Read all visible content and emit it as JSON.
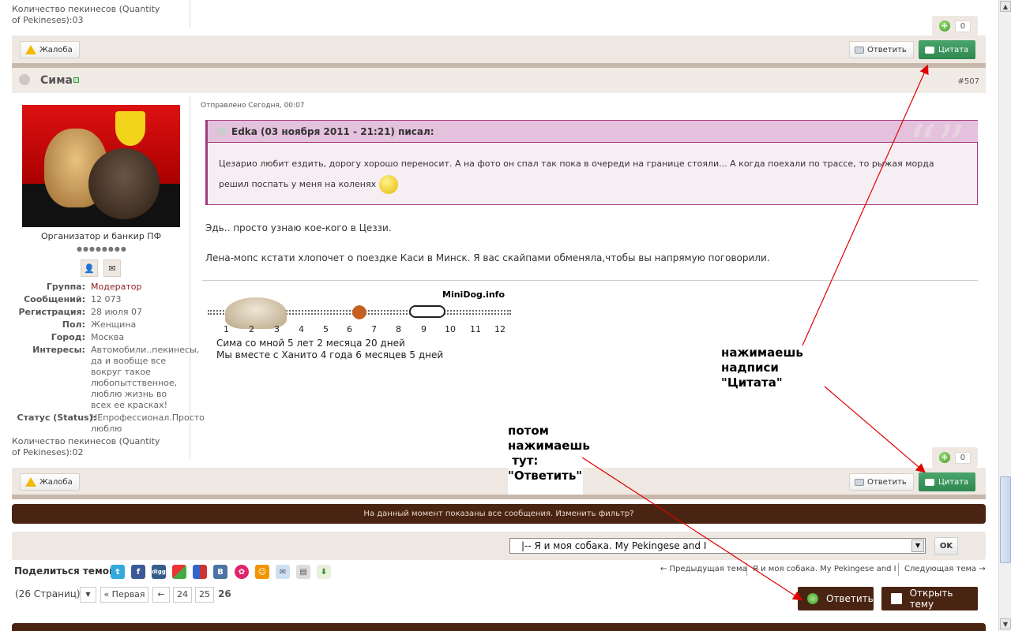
{
  "prev_post": {
    "pekingese_count": "Количество пекинесов (Quantity of Pekineses):03",
    "rep_count": "0",
    "report_label": "Жалоба",
    "reply_label": "Ответить",
    "quote_label": "Цитата"
  },
  "post": {
    "author": "Сима",
    "number": "#507",
    "sent": "Отправлено Сегодня, 00:07",
    "user_title": "Организатор и банкир ПФ",
    "pips": "●●●●●●●●",
    "profile": [
      {
        "label": "Группа:",
        "value": "Модератор"
      },
      {
        "label": "Сообщений:",
        "value": "12 073"
      },
      {
        "label": "Регистрация:",
        "value": "28 июля 07"
      },
      {
        "label": "Пол:",
        "value": "Женщина"
      },
      {
        "label": "Город:",
        "value": "Москва"
      },
      {
        "label": "Интересы:",
        "value": "Автомобили..пекинесы, да и вообще все вокруг такое любопытственное, люблю жизнь во всех ее красках!"
      },
      {
        "label": "Статус (Status):",
        "value": "НЕпрофессионал.Просто люблю"
      }
    ],
    "pekingese_count": "Количество пекинесов (Quantity of Pekineses):02",
    "quote_head": "Edka (03 ноября 2011 - 21:21) писал:",
    "quote_text": "Цезарио любит ездить, дорогу хорошо переносит. А на фото он спал так пока в очереди на границе стояли... А когда поехали по трассе, то рыжая морда решил поспать у меня на коленях",
    "line1": "Эдь.. просто узнаю кое-кого в Цеззи.",
    "line2": "Лена-мопс кстати хлопочет о поездке Каси в Минск. Я вас скайпами обменяла,чтобы вы напрямую поговорили.",
    "sig_site": "MiniDog.info",
    "sig_nums": [
      "1",
      "2",
      "3",
      "4",
      "5",
      "6",
      "7",
      "8",
      "9",
      "10",
      "11",
      "12"
    ],
    "sig_line1": "Сима со мной 5 лет 2 месяца 20 дней",
    "sig_line2": "Мы вместе с Ханито 4 года 6 месяцев 5 дней",
    "rep_count": "0",
    "report_label": "Жалоба",
    "reply_label": "Ответить",
    "quote_label": "Цитата"
  },
  "annotations": {
    "quote_hint": "нажимаешь\nнадписи\n\"Цитата\"",
    "reply_hint": "потом\nнажимаешь\n тут:\n\"Ответить\""
  },
  "filter_notice": "На данный момент показаны все сообщения. Изменить фильтр?",
  "jump": {
    "selected": "|-- Я и моя собака. My Pekingese and I",
    "ok_label": "OK"
  },
  "share": {
    "label": "Поделиться темой:",
    "icons": [
      "twitter-icon",
      "facebook-icon",
      "digg-icon",
      "google-icon",
      "delicious-icon",
      "vkontakte-icon",
      "moimir-icon",
      "odnoklassniki-icon",
      "email-icon",
      "print-icon",
      "download-icon"
    ]
  },
  "topic_nav": {
    "prev": "← Предыдущая тема",
    "current": "Я и моя собака. My Pekingese and I",
    "next": "Следующая тема →"
  },
  "pagination": {
    "label": "(26 Страниц)",
    "first": "« Первая",
    "prev": "←",
    "pages": [
      "24",
      "25"
    ],
    "current": "26"
  },
  "actions": {
    "reply": "Ответить",
    "new_topic": "Открыть тему"
  },
  "colors": {
    "brand_dark": "#4a2412",
    "quote_green": "#2e8850",
    "quote_border": "#a33a80",
    "annotation_arrow": "#e00000"
  }
}
